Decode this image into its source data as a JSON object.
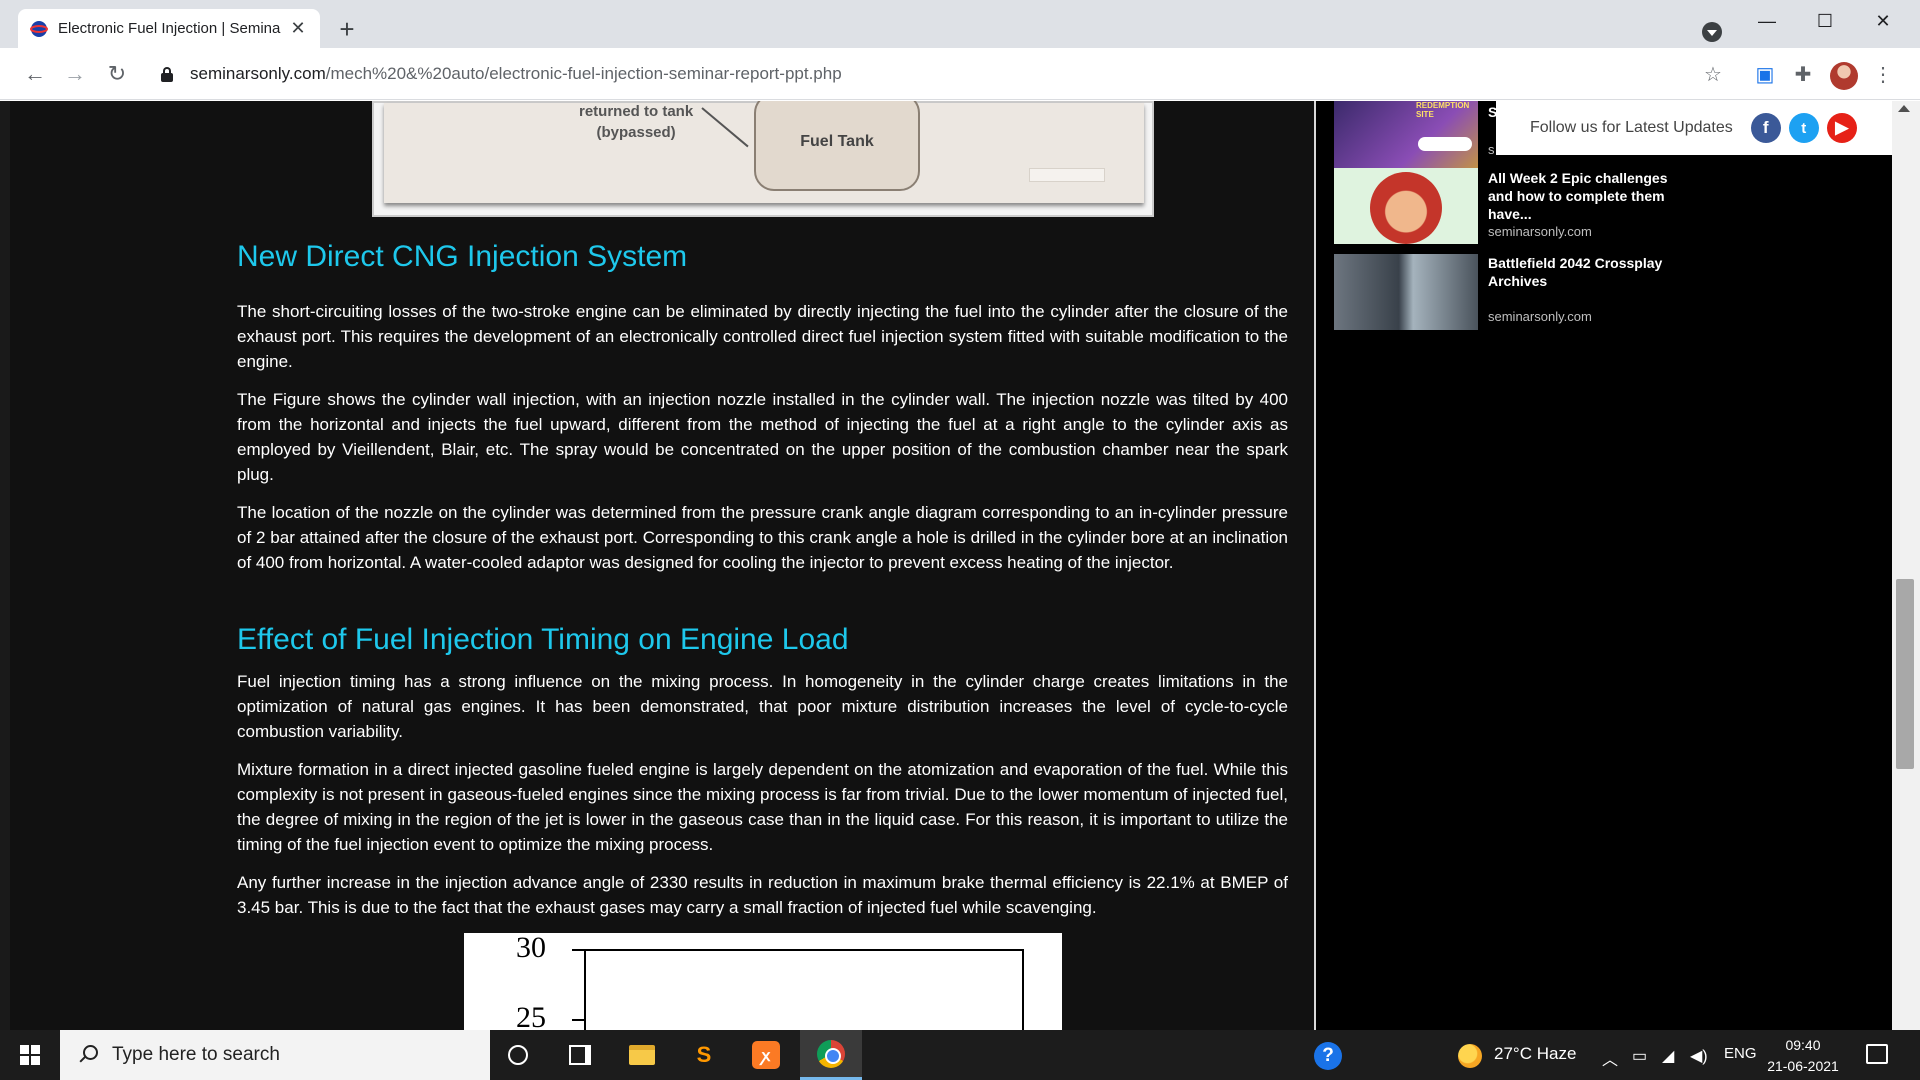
{
  "browser": {
    "tab_title": "Electronic Fuel Injection | Semina",
    "new_tab_symbol": "+",
    "url_host": "seminarsonly.com",
    "url_path": "/mech%20&%20auto/electronic-fuel-injection-seminar-report-ppt.php"
  },
  "figure_top": {
    "returned_label": "returned to tank\n(bypassed)",
    "tank_label": "Fuel Tank"
  },
  "article": {
    "heading1": "New Direct CNG Injection System",
    "p1": "The short-circuiting losses of the two-stroke engine can be eliminated by directly injecting the fuel into the cylinder after the closure of the exhaust port. This requires the development of an electronically controlled direct fuel injection system fitted with suitable modification to the engine.",
    "p2": "The Figure shows the cylinder wall injection, with an injection nozzle installed in the cylinder wall. The injection nozzle was tilted by 400 from the horizontal and injects the fuel upward, different from the method of injecting the fuel at a right angle to the cylinder axis as employed by Vieillendent, Blair, etc. The spray would be concentrated on the upper position of the combustion chamber near the spark plug.",
    "p3": "The location of the nozzle on the cylinder was determined from the pressure crank angle diagram corresponding to an in-cylinder pressure of 2 bar attained after the closure of the exhaust port. Corresponding to this crank angle a hole is drilled in the cylinder bore at an inclination of 400 from horizontal. A water-cooled adaptor was designed for cooling the injector to prevent excess heating of the injector.",
    "heading2": "Effect of Fuel Injection Timing on Engine Load",
    "p4": "Fuel injection timing has a strong influence on the mixing process. In homogeneity in the cylinder charge creates limitations in the optimization of natural gas engines. It has been demonstrated, that poor mixture distribution increases the level of cycle-to-cycle combustion variability.",
    "p5": "Mixture formation in a direct injected gasoline fueled engine is largely dependent on the atomization and evaporation of the fuel. While this complexity is not present in gaseous-fueled engines since the mixing process is far from trivial. Due to the lower momentum of injected fuel, the degree of mixing in the region of the jet is lower in the gaseous case than in the liquid case. For this reason, it is important to utilize the timing of the fuel injection event to optimize the mixing process.",
    "p6": "Any further increase in the injection advance angle of 2330 results in reduction in maximum brake thermal efficiency is 22.1% at BMEP of 3.45 bar. This is due to the fact that the exhaust gases may carry a small fraction of injected fuel while scavenging."
  },
  "figure_bottom": {
    "tick_30": "30",
    "tick_25": "25"
  },
  "sidebar": {
    "follow_text": "Follow us for Latest Updates",
    "item0_partial_title": "S",
    "item0_partial_site": "s",
    "thumb0_text": "REDEMPTION SITE",
    "items": [
      {
        "title": "All Week 2 Epic challenges and how to complete them have...",
        "site": "seminarsonly.com"
      },
      {
        "title": "Battlefield 2042 Crossplay Archives",
        "site": "seminarsonly.com"
      }
    ]
  },
  "taskbar": {
    "search_placeholder": "Type here to search",
    "weather": "27°C  Haze",
    "language": "ENG",
    "time": "09:40",
    "date": "21-06-2021"
  },
  "colors": {
    "heading": "#1ec8ec",
    "page_bg": "#111111",
    "sidebar_bg": "#000000"
  }
}
